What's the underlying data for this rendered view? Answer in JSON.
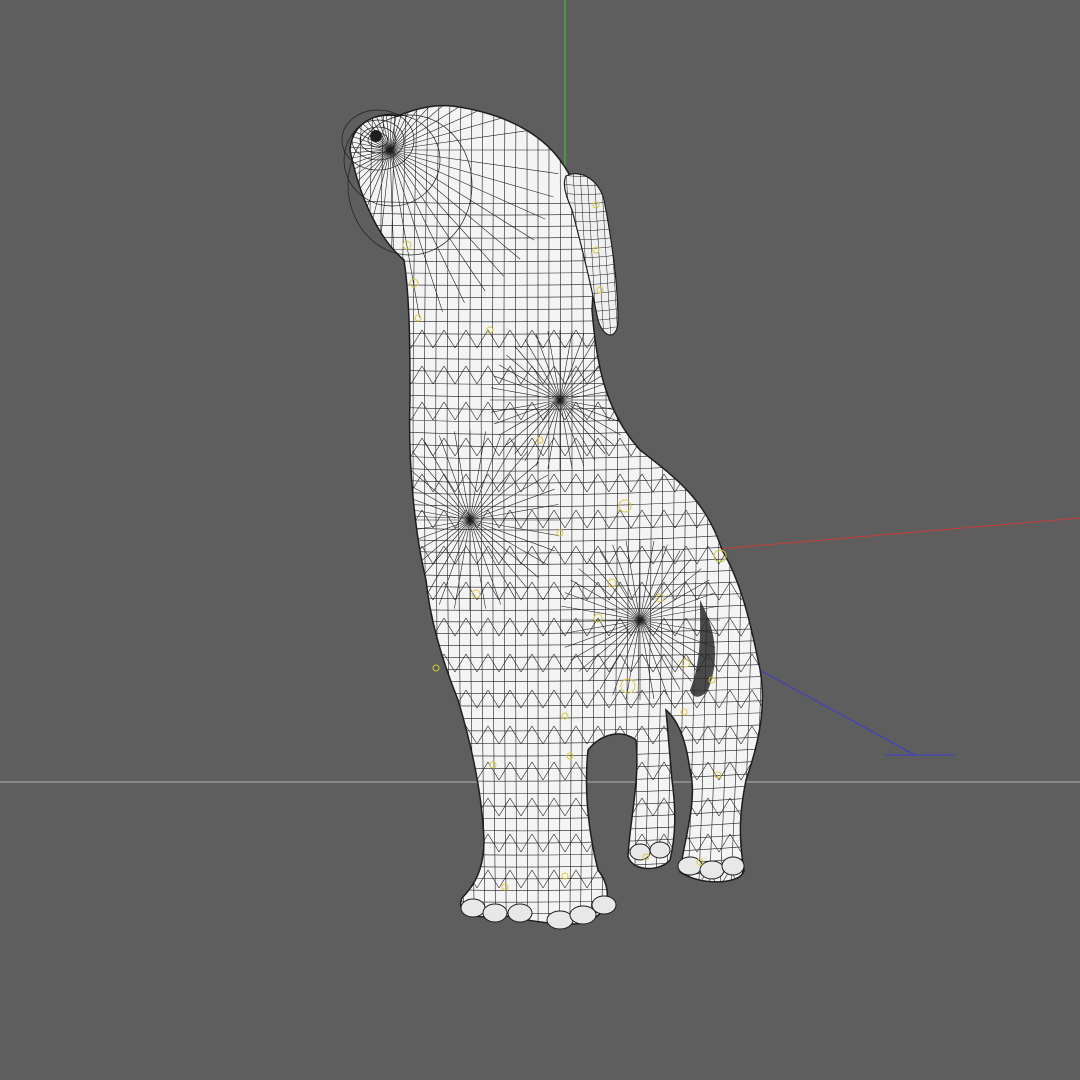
{
  "viewport": {
    "background_color": "#5e5e5e",
    "grid_line_color": "#b4b4b4",
    "axes": {
      "x_axis_color": "#c83c3c",
      "y_axis_color": "#3cc83c",
      "z_axis_color": "#3c3cd2"
    }
  },
  "model": {
    "name_icon": "dog-wireframe-model",
    "surface_color": "#f4f4f4",
    "wire_color": "#1e1e1e",
    "bone_marker_color": "#d8c840",
    "display_mode": "wireframe-on-shaded"
  }
}
